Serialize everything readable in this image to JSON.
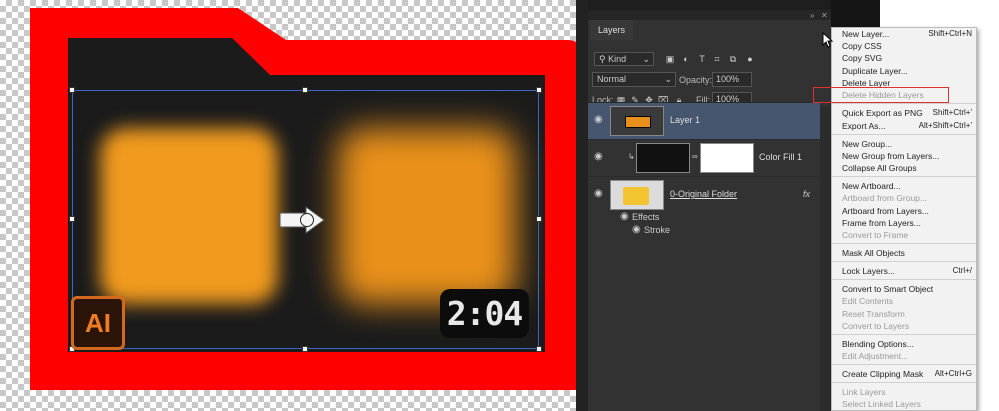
{
  "canvas": {
    "folder_color": "#ff0000",
    "inner_color": "#1a1a1a",
    "ai_badge": "AI",
    "time_badge": "2:04"
  },
  "panel": {
    "tab": "Layers",
    "kind": "Kind",
    "blend_mode": "Normal",
    "opacity_label": "Opacity:",
    "opacity_value": "100%",
    "lock_label": "Lock:",
    "fill_label": "Fill:",
    "fill_value": "100%",
    "layers": [
      {
        "name": "Layer 1"
      },
      {
        "name": "Color Fill 1"
      },
      {
        "name": "0-Original Folder"
      }
    ],
    "effects_label": "Effects",
    "stroke_label": "Stroke",
    "fx_label": "fx"
  },
  "menu": {
    "items": [
      {
        "label": "New Layer...",
        "shortcut": "Shift+Ctrl+N"
      },
      {
        "label": "Copy CSS",
        "shortcut": ""
      },
      {
        "label": "Copy SVG",
        "shortcut": ""
      },
      {
        "label": "Duplicate Layer...",
        "shortcut": ""
      },
      {
        "label": "Delete Layer",
        "shortcut": ""
      },
      {
        "label": "Delete Hidden Layers",
        "shortcut": ""
      },
      {
        "label": "Quick Export as PNG",
        "shortcut": "Shift+Ctrl+'"
      },
      {
        "label": "Export As...",
        "shortcut": "Alt+Shift+Ctrl+'"
      },
      {
        "label": "New Group...",
        "shortcut": ""
      },
      {
        "label": "New Group from Layers...",
        "shortcut": ""
      },
      {
        "label": "Collapse All Groups",
        "shortcut": ""
      },
      {
        "label": "New Artboard...",
        "shortcut": ""
      },
      {
        "label": "Artboard from Group...",
        "shortcut": ""
      },
      {
        "label": "Artboard from Layers...",
        "shortcut": ""
      },
      {
        "label": "Frame from Layers...",
        "shortcut": ""
      },
      {
        "label": "Convert to Frame",
        "shortcut": ""
      },
      {
        "label": "Mask All Objects",
        "shortcut": ""
      },
      {
        "label": "Lock Layers...",
        "shortcut": "Ctrl+/"
      },
      {
        "label": "Convert to Smart Object",
        "shortcut": ""
      },
      {
        "label": "Edit Contents",
        "shortcut": ""
      },
      {
        "label": "Reset Transform",
        "shortcut": ""
      },
      {
        "label": "Convert to Layers",
        "shortcut": ""
      },
      {
        "label": "Blending Options...",
        "shortcut": ""
      },
      {
        "label": "Edit Adjustment...",
        "shortcut": ""
      },
      {
        "label": "Create Clipping Mask",
        "shortcut": "Alt+Ctrl+G"
      },
      {
        "label": "Link Layers",
        "shortcut": ""
      },
      {
        "label": "Select Linked Layers",
        "shortcut": ""
      }
    ]
  }
}
